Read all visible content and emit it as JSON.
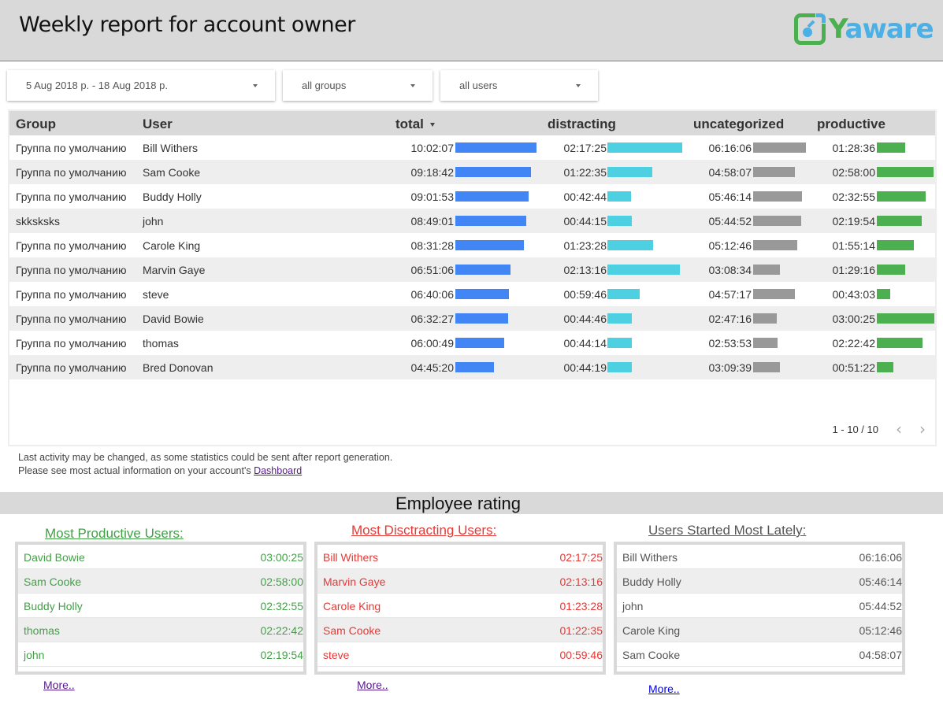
{
  "header": {
    "title": "Weekly report for account owner",
    "logo_y": "Y",
    "logo_rest": "aware"
  },
  "filters": {
    "date_range": "5 Aug 2018 р. - 18 Aug 2018 р.",
    "group": "all groups",
    "user": "all users"
  },
  "colors": {
    "total": "#4285f4",
    "distracting": "#4dd0e1",
    "uncategorized": "#999999",
    "productive": "#4caf50",
    "productive_text": "#43a047",
    "distracting_text": "#e53935",
    "lately_text": "#555555"
  },
  "table": {
    "columns": {
      "group": "Group",
      "user": "User",
      "total": "total",
      "distracting": "distracting",
      "uncategorized": "uncategorized",
      "productive": "productive"
    },
    "sort_column": "total",
    "rows": [
      {
        "group": "Группа по умолчанию",
        "user": "Bill Withers",
        "total": "10:02:07",
        "distracting": "02:17:25",
        "uncategorized": "06:16:06",
        "productive": "01:28:36"
      },
      {
        "group": "Группа по умолчанию",
        "user": "Sam Cooke",
        "total": "09:18:42",
        "distracting": "01:22:35",
        "uncategorized": "04:58:07",
        "productive": "02:58:00"
      },
      {
        "group": "Группа по умолчанию",
        "user": "Buddy Holly",
        "total": "09:01:53",
        "distracting": "00:42:44",
        "uncategorized": "05:46:14",
        "productive": "02:32:55"
      },
      {
        "group": "skksksks",
        "user": "john",
        "total": "08:49:01",
        "distracting": "00:44:15",
        "uncategorized": "05:44:52",
        "productive": "02:19:54"
      },
      {
        "group": "Группа по умолчанию",
        "user": "Carole King",
        "total": "08:31:28",
        "distracting": "01:23:28",
        "uncategorized": "05:12:46",
        "productive": "01:55:14"
      },
      {
        "group": "Группа по умолчанию",
        "user": "Marvin Gaye",
        "total": "06:51:06",
        "distracting": "02:13:16",
        "uncategorized": "03:08:34",
        "productive": "01:29:16"
      },
      {
        "group": "Группа по умолчанию",
        "user": "steve",
        "total": "06:40:06",
        "distracting": "00:59:46",
        "uncategorized": "04:57:17",
        "productive": "00:43:03"
      },
      {
        "group": "Группа по умолчанию",
        "user": "David Bowie",
        "total": "06:32:27",
        "distracting": "00:44:46",
        "uncategorized": "02:47:16",
        "productive": "03:00:25"
      },
      {
        "group": "Группа по умолчанию",
        "user": "thomas",
        "total": "06:00:49",
        "distracting": "00:44:14",
        "uncategorized": "02:53:53",
        "productive": "02:22:42"
      },
      {
        "group": "Группа по умолчанию",
        "user": "Bred Donovan",
        "total": "04:45:20",
        "distracting": "00:44:19",
        "uncategorized": "03:09:39",
        "productive": "00:51:22"
      }
    ],
    "pagination": "1 - 10 / 10",
    "prev_icon": "‹",
    "next_icon": "›"
  },
  "note": {
    "line1": "Last activity may be changed, as some statistics could be sent after report generation.",
    "line2": "Please see most actual information on your account's ",
    "link": "Dashboard"
  },
  "rating": {
    "title": "Employee rating",
    "productive": {
      "title": "Most Productive Users:",
      "items": [
        {
          "name": "David Bowie",
          "value": "03:00:25"
        },
        {
          "name": "Sam Cooke",
          "value": "02:58:00"
        },
        {
          "name": "Buddy Holly",
          "value": "02:32:55"
        },
        {
          "name": "thomas",
          "value": "02:22:42"
        },
        {
          "name": "john",
          "value": "02:19:54"
        }
      ],
      "more": "More.."
    },
    "distracting": {
      "title": "Most Disctracting Users:",
      "items": [
        {
          "name": "Bill Withers",
          "value": "02:17:25"
        },
        {
          "name": "Marvin Gaye",
          "value": "02:13:16"
        },
        {
          "name": "Carole King",
          "value": "01:23:28"
        },
        {
          "name": "Sam Cooke",
          "value": "01:22:35"
        },
        {
          "name": "steve",
          "value": "00:59:46"
        }
      ],
      "more": "More.."
    },
    "lately": {
      "title": "Users Started Most Lately:",
      "items": [
        {
          "name": "Bill Withers",
          "value": "06:16:06"
        },
        {
          "name": "Buddy Holly",
          "value": "05:46:14"
        },
        {
          "name": "john",
          "value": "05:44:52"
        },
        {
          "name": "Carole King",
          "value": "05:12:46"
        },
        {
          "name": "Sam Cooke",
          "value": "04:58:07"
        }
      ],
      "more": "More.."
    }
  }
}
